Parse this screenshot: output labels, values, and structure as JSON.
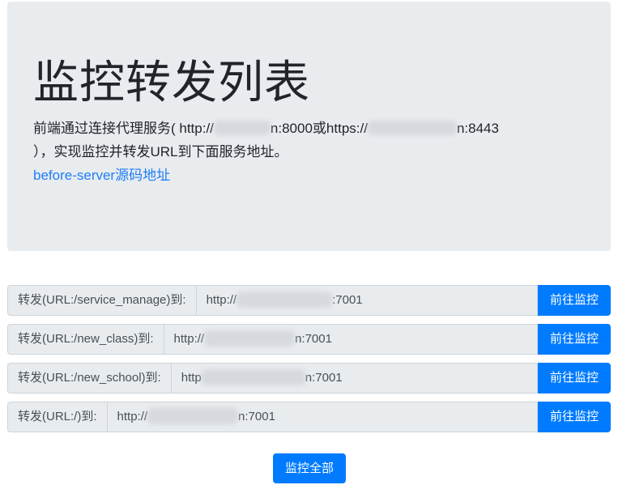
{
  "header": {
    "title": "监控转发列表",
    "desc_before": "前端通过连接代理服务( http://",
    "desc_mid1": "n:8000或https://",
    "desc_mid2": "n:8443",
    "desc_after": "），实现监控并转发URL到下面服务地址。",
    "link_label": "before-server源码地址"
  },
  "rows": [
    {
      "prefix": "转发(URL:/service_manage)到:",
      "url_start": "http://",
      "url_end": ":7001",
      "button": "前往监控"
    },
    {
      "prefix": "转发(URL:/new_class)到:",
      "url_start": "http://",
      "url_end": "n:7001",
      "button": "前往监控"
    },
    {
      "prefix": "转发(URL:/new_school)到:",
      "url_start": "http",
      "url_end": "n:7001",
      "button": "前往监控"
    },
    {
      "prefix": "转发(URL:/)到:",
      "url_start": "http://",
      "url_end": "n:7001",
      "button": "前往监控"
    }
  ],
  "footer": {
    "monitor_all_label": "监控全部"
  }
}
